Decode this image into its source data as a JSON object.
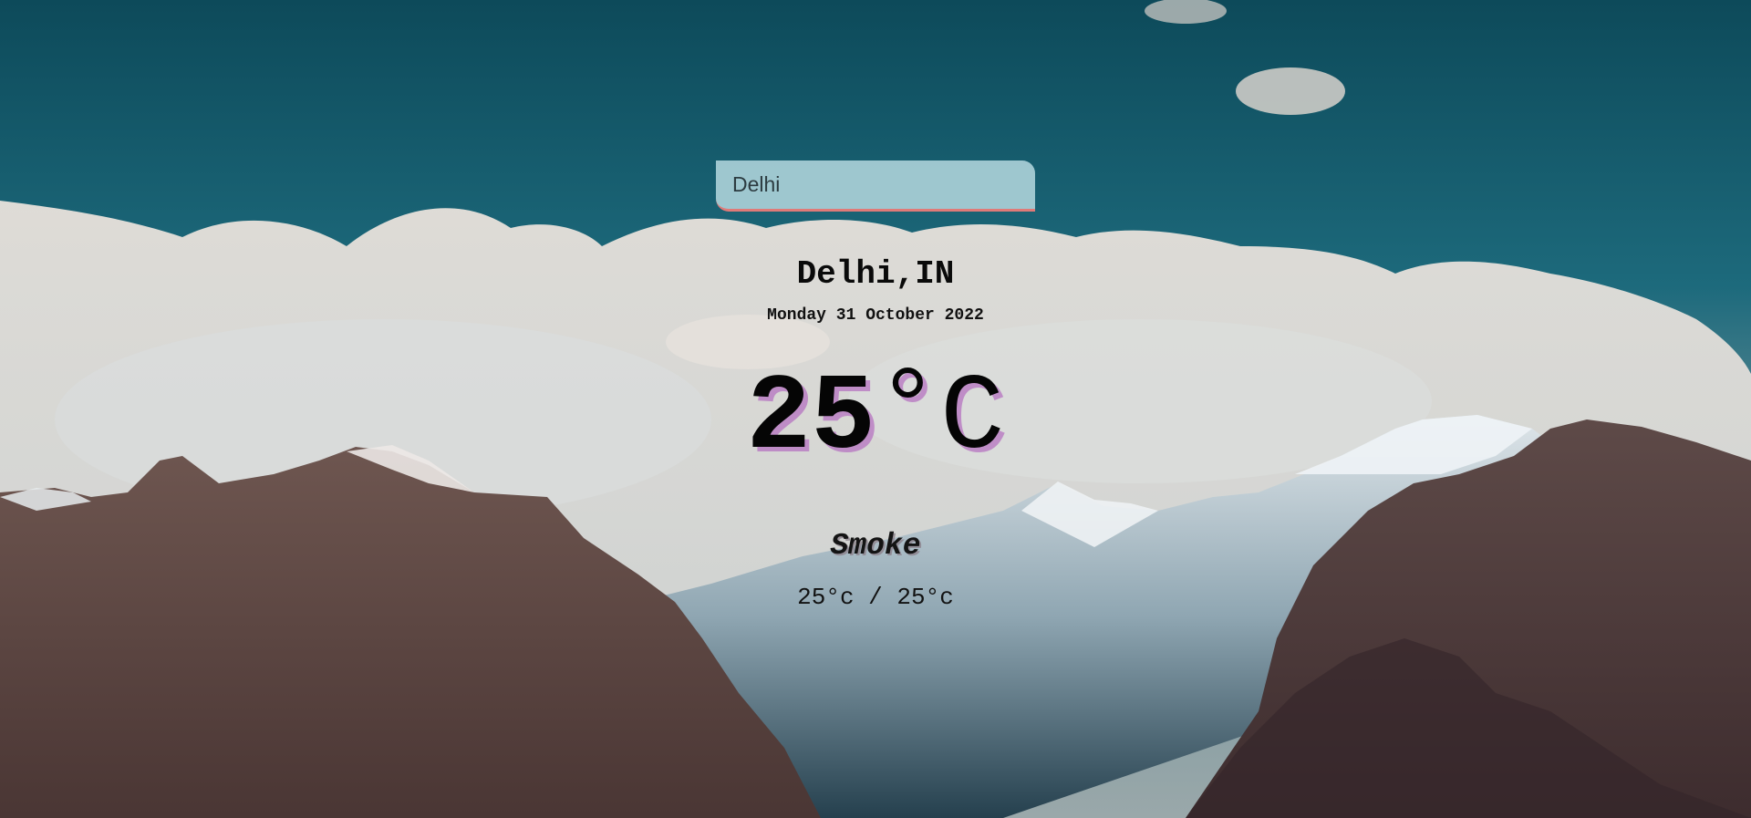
{
  "search": {
    "value": "Delhi",
    "placeholder": ""
  },
  "weather": {
    "location": "Delhi,IN",
    "date": "Monday 31 October 2022",
    "temp_value": "25",
    "temp_degree": "°",
    "temp_unit": "C",
    "condition": "Smoke",
    "hi_low": "25°c / 25°c"
  },
  "colors": {
    "accent": "#e07a78",
    "temp_shadow": "#bb84c4",
    "search_bg": "#bcdee4"
  }
}
